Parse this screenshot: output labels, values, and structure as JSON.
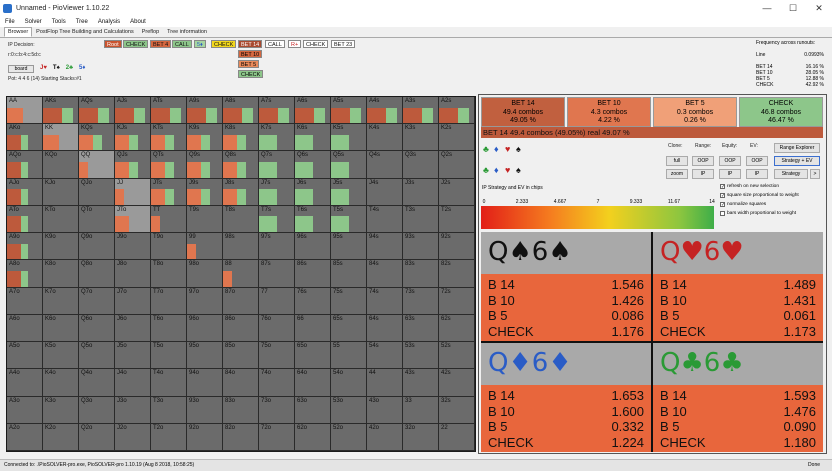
{
  "window": {
    "title": "Unnamed - PioViewer 1.10.22",
    "controls": {
      "minimize": "—",
      "maximize": "☐",
      "close": "✕"
    }
  },
  "menu": [
    "File",
    "Solver",
    "Tools",
    "Tree",
    "Analysis",
    "About"
  ],
  "tabs": [
    "Browser",
    "PostFlop Tree Building and Calculations",
    "Preflop",
    "Tree information"
  ],
  "info": {
    "ip_decision": "IP Decision:",
    "line_path": "r:0:c:b:4:c:5d:c",
    "board_button": "board",
    "board_cards": [
      {
        "text": "J♥",
        "color": "#c52323"
      },
      {
        "text": "T♠",
        "color": "#111111"
      },
      {
        "text": "2♣",
        "color": "#2a9a35"
      },
      {
        "text": "5♦",
        "color": "#2a5cc6"
      }
    ],
    "pot_line": "Pot: 4 4 6 (14) Starting Stacks:#1"
  },
  "tree_nodes": [
    {
      "label": "Root",
      "bg": "#c9542f",
      "color": "#ffffff"
    },
    {
      "label": "CHECK",
      "bg": "#8dc68a",
      "color": "#111111"
    },
    {
      "label": "BET 4",
      "bg": "#d5673f",
      "color": "#111111"
    },
    {
      "label": "CALL",
      "bg": "#8dc68a",
      "color": "#111111"
    },
    {
      "label": "5♦",
      "bg": "#a7d6a0",
      "color": "#2a5cc6"
    },
    {
      "label": "CHECK",
      "bg": "#f3d81e",
      "color": "#111111"
    },
    {
      "label": "BET 14",
      "bg": "#a94a30",
      "color": "#ffffff"
    },
    {
      "label": "CALL",
      "bg": "#ffffff",
      "color": "#111111"
    },
    {
      "label": "R+",
      "bg": "#ffffff",
      "color": "#c52323"
    },
    {
      "label": "CHECK",
      "bg": "#ffffff",
      "color": "#111111"
    },
    {
      "label": "BET 23",
      "bg": "#ffffff",
      "color": "#111111"
    }
  ],
  "sub_nodes": [
    {
      "label": "BET 10",
      "bg": "#d5673f"
    },
    {
      "label": "BET 5",
      "bg": "#ea8a5a"
    },
    {
      "label": "CHECK",
      "bg": "#8dc68a"
    }
  ],
  "frequency": {
    "header": "Frequency across runouts:",
    "line_label": "Line",
    "line_value": "0.0993%",
    "rows": [
      {
        "label": "BET 14",
        "value": "16.16 %"
      },
      {
        "label": "BET 10",
        "value": "28.05 %"
      },
      {
        "label": "BET 5",
        "value": "12.88 %"
      },
      {
        "label": "CHECK",
        "value": "42.92 %"
      }
    ]
  },
  "grid": {
    "cells": [
      [
        "AA",
        "AKs",
        "AQs",
        "AJs",
        "ATs",
        "A9s",
        "A8s",
        "A7s",
        "A6s",
        "A5s",
        "A4s",
        "A3s",
        "A2s"
      ],
      [
        "AKo",
        "KK",
        "KQs",
        "KJs",
        "KTs",
        "K9s",
        "K8s",
        "K7s",
        "K6s",
        "K5s",
        "K4s",
        "K3s",
        "K2s"
      ],
      [
        "AQo",
        "KQo",
        "QQ",
        "QJs",
        "QTs",
        "Q9s",
        "Q8s",
        "Q7s",
        "Q6s",
        "Q5s",
        "Q4s",
        "Q3s",
        "Q2s"
      ],
      [
        "AJo",
        "KJo",
        "QJo",
        "JJ",
        "JTs",
        "J9s",
        "J8s",
        "J7s",
        "J6s",
        "J5s",
        "J4s",
        "J3s",
        "J2s"
      ],
      [
        "ATo",
        "KTo",
        "QTo",
        "JTo",
        "TT",
        "T9s",
        "T8s",
        "T7s",
        "T6s",
        "T5s",
        "T4s",
        "T3s",
        "T2s"
      ],
      [
        "A9o",
        "K9o",
        "Q9o",
        "J9o",
        "T9o",
        "99",
        "98s",
        "97s",
        "96s",
        "95s",
        "94s",
        "93s",
        "92s"
      ],
      [
        "A8o",
        "K8o",
        "Q8o",
        "J8o",
        "T8o",
        "98o",
        "88",
        "87s",
        "86s",
        "85s",
        "84s",
        "83s",
        "82s"
      ],
      [
        "A7o",
        "K7o",
        "Q7o",
        "J7o",
        "T7o",
        "97o",
        "87o",
        "77",
        "76s",
        "75s",
        "74s",
        "73s",
        "72s"
      ],
      [
        "A6o",
        "K6o",
        "Q6o",
        "J6o",
        "T6o",
        "96o",
        "86o",
        "76o",
        "66",
        "65s",
        "64s",
        "63s",
        "62s"
      ],
      [
        "A5o",
        "K5o",
        "Q5o",
        "J5o",
        "T5o",
        "95o",
        "85o",
        "75o",
        "65o",
        "55",
        "54s",
        "53s",
        "52s"
      ],
      [
        "A4o",
        "K4o",
        "Q4o",
        "J4o",
        "T4o",
        "94o",
        "84o",
        "74o",
        "64o",
        "54o",
        "44",
        "43s",
        "42s"
      ],
      [
        "A3o",
        "K3o",
        "Q3o",
        "J3o",
        "T3o",
        "93o",
        "83o",
        "73o",
        "63o",
        "53o",
        "43o",
        "33",
        "32s"
      ],
      [
        "A2o",
        "K2o",
        "Q2o",
        "J2o",
        "T2o",
        "92o",
        "82o",
        "72o",
        "62o",
        "52o",
        "42o",
        "32o",
        "22"
      ]
    ]
  },
  "strategy_boxes": [
    {
      "name": "BET 14",
      "combos": "49.4 combos",
      "pct": "49.05 %",
      "bg": "#c1603f"
    },
    {
      "name": "BET 10",
      "combos": "4.3 combos",
      "pct": "4.22 %",
      "bg": "#e0764f"
    },
    {
      "name": "BET 5",
      "combos": "0.3 combos",
      "pct": "0.26 %",
      "bg": "#f0a078"
    },
    {
      "name": "CHECK",
      "combos": "46.8 combos",
      "pct": "46.47 %",
      "bg": "#8dc68a"
    }
  ],
  "strategy_bar": "BET 14   49.4 combos (49.05%) real  49.07 %",
  "suit_rows": [
    [
      {
        "s": "♣",
        "c": "#2a9a35"
      },
      {
        "s": "♦",
        "c": "#2a5cc6"
      },
      {
        "s": "♥",
        "c": "#c52323"
      },
      {
        "s": "♠",
        "c": "#111111"
      }
    ],
    [
      {
        "s": "♣",
        "c": "#2a9a35"
      },
      {
        "s": "♦",
        "c": "#2a5cc6"
      },
      {
        "s": "♥",
        "c": "#c52323"
      },
      {
        "s": "♠",
        "c": "#111111"
      }
    ]
  ],
  "controls": {
    "clone": "Clone:",
    "range": "Range:",
    "equity": "Equity:",
    "ev": "EV:",
    "full": "full",
    "zoom": "zoom",
    "oop": "OOP",
    "ip": "IP",
    "range_explorer": "Range Explorer",
    "strategy_ev": "Strategy + EV",
    "strategy": "Strategy",
    "arrow": ">"
  },
  "checkboxes": [
    {
      "label": "refresh on new selection",
      "checked": true
    },
    {
      "label": "square size proportional to weight",
      "checked": true
    },
    {
      "label": "normalize squares",
      "checked": true
    },
    {
      "label": "bars width proportional to weight",
      "checked": false
    }
  ],
  "ev_scale": {
    "title": "IP Strategy and EV in chips",
    "ticks": [
      "0",
      "2.333",
      "4.667",
      "7",
      "9.333",
      "11.67",
      "14"
    ]
  },
  "combos": [
    {
      "cards": [
        {
          "r": "Q",
          "s": "♠"
        },
        {
          "r": "6",
          "s": "♠"
        }
      ],
      "color": "#111111",
      "rows": [
        {
          "label": "B 14",
          "value": "1.546"
        },
        {
          "label": "B 10",
          "value": "1.426"
        },
        {
          "label": "B 5",
          "value": "0.086"
        },
        {
          "label": "CHECK",
          "value": "1.176"
        }
      ]
    },
    {
      "cards": [
        {
          "r": "Q",
          "s": "♥"
        },
        {
          "r": "6",
          "s": "♥"
        }
      ],
      "color": "#c52323",
      "rows": [
        {
          "label": "B 14",
          "value": "1.489"
        },
        {
          "label": "B 10",
          "value": "1.431"
        },
        {
          "label": "B 5",
          "value": "0.061"
        },
        {
          "label": "CHECK",
          "value": "1.173"
        }
      ]
    },
    {
      "cards": [
        {
          "r": "Q",
          "s": "♦"
        },
        {
          "r": "6",
          "s": "♦"
        }
      ],
      "color": "#2a5cc6",
      "rows": [
        {
          "label": "B 14",
          "value": "1.653"
        },
        {
          "label": "B 10",
          "value": "1.600"
        },
        {
          "label": "B 5",
          "value": "0.332"
        },
        {
          "label": "CHECK",
          "value": "1.224"
        }
      ]
    },
    {
      "cards": [
        {
          "r": "Q",
          "s": "♣"
        },
        {
          "r": "6",
          "s": "♣"
        }
      ],
      "color": "#2a9a35",
      "rows": [
        {
          "label": "B 14",
          "value": "1.593"
        },
        {
          "label": "B 10",
          "value": "1.476"
        },
        {
          "label": "B 5",
          "value": "0.090"
        },
        {
          "label": "CHECK",
          "value": "1.180"
        }
      ]
    }
  ],
  "status": {
    "text": "Connected to: .\\PioSOLVER-pro.exe, PioSOLVER-pro 1.10.19 (Aug 8 2018, 10:58:25)",
    "done": "Done"
  },
  "colors": {
    "bet_dark": "#bd5a3c",
    "bet_light": "#e0764f",
    "check_green": "#8dc68a",
    "cell_grey": "#6b6b6b",
    "cell_light": "#9a9a9a"
  }
}
